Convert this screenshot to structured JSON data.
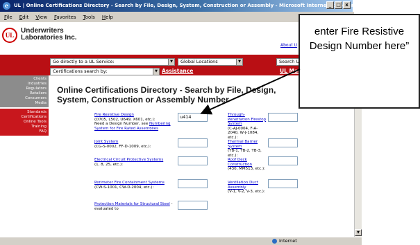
{
  "window": {
    "title": "UL | Online Certifications Directory - Search by File, Design, System, Construction or Assembly - Microsoft Internet Explorer p",
    "min": "_",
    "max": "□",
    "close": "x"
  },
  "menu": [
    "File",
    "Edit",
    "View",
    "Favorites",
    "Tools",
    "Help"
  ],
  "header": {
    "logo_text": "UL",
    "company_line1": "Underwriters",
    "company_line2": "Laboratories Inc.",
    "about_link": "About U"
  },
  "redbar": {
    "service_select": "Go directly to a UL Service:",
    "location_select": "Global Locations",
    "search_input": "Search UL.com",
    "cert_select": "Certifications search by:",
    "assistance": "Assistance",
    "ul_marks": "UL Marks"
  },
  "nav": {
    "gray_items": [
      "Clients",
      "Industries",
      "Regulators",
      "Retailers",
      "Consumers",
      "Media"
    ],
    "red_items": [
      "Standards",
      "Certifications",
      "Online Tools",
      "Training",
      "FAQ"
    ]
  },
  "page_title": "Online Certifications Directory - Search by File, Design, System, Construction or Assembly Number",
  "fields_left": [
    {
      "link": "Fire Resistive Design",
      "desc": "(D705, L502, U649, X601, etc.):\nNeed a Design Number, see",
      "link2": "Numbering System for Fire Rated Assemblies",
      "value": "u414"
    },
    {
      "link": "Joint System",
      "desc": "(CG-S-0002, FF-D-1009, etc.):",
      "link2": "",
      "value": ""
    },
    {
      "link": "Electrical Circuit Protective Systems",
      "desc": "(1, 8, 25, etc.):",
      "link2": "",
      "value": ""
    },
    {
      "link": "Perimeter Fire Containment Systems",
      "desc": "(CW-S-1001, CW-D-2004, etc.):",
      "link2": "",
      "value": ""
    },
    {
      "link": "Protection Materials for Structural Steel",
      "desc": "- evaluated to",
      "link2": "",
      "value": ""
    }
  ],
  "fields_right": [
    {
      "link": "Through-Penetration Firestop System",
      "desc": "(C-AJ-0004, F-A-2040, W-J-1084, etc.):",
      "value": ""
    },
    {
      "link": "Thermal Barrier System",
      "desc": "(TB-1, TB-2, TB-3, etc.):",
      "value": ""
    },
    {
      "link": "Roof Deck Construction",
      "desc": "(430, MM513, etc.):",
      "value": ""
    },
    {
      "link": "Ventilation Duct Assembly",
      "desc": "(V-1, V-2, V-3, etc.):",
      "value": ""
    }
  ],
  "status": {
    "zone": "Internet"
  },
  "callout": {
    "text": "enter Fire Resistive Design Number here”"
  }
}
